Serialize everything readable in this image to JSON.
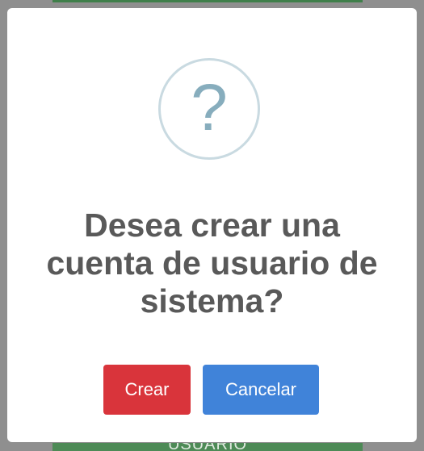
{
  "dialog": {
    "icon": "question-icon",
    "icon_glyph": "?",
    "title": "Desea crear una cuenta de usuario de sistema?",
    "confirm_label": "Crear",
    "cancel_label": "Cancelar"
  },
  "background": {
    "bottom_button_label": "USUARIO"
  },
  "colors": {
    "overlay": "#8f8f8f",
    "confirm": "#d9343b",
    "cancel": "#4083d9",
    "icon": "#87adbd",
    "icon_ring": "#c9dae1",
    "title": "#595959"
  }
}
